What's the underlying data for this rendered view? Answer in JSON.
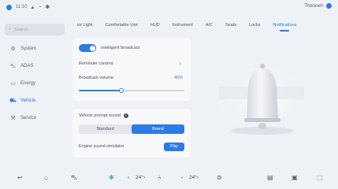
{
  "status_bar": {
    "time": "11:10",
    "left_glyphs": [
      "signal-icon",
      "wifi-icon",
      "bluetooth-icon"
    ],
    "right_text": "Theoneh",
    "right_glyph": "car-icon"
  },
  "sidebar": {
    "search_placeholder": "Search",
    "items": [
      {
        "label": "System",
        "icon": "gear-icon",
        "active": false
      },
      {
        "label": "ADAS",
        "icon": "car-front-icon",
        "active": false
      },
      {
        "label": "Energy",
        "icon": "battery-icon",
        "active": false
      },
      {
        "label": "Vehicle",
        "icon": "vehicle-icon",
        "active": true
      },
      {
        "label": "Service",
        "icon": "service-icon",
        "active": false
      }
    ]
  },
  "tabs": [
    {
      "label": "ior Light",
      "active": false
    },
    {
      "label": "Comfortable Use",
      "active": false
    },
    {
      "label": "HUD",
      "active": false
    },
    {
      "label": "Instrument",
      "active": false
    },
    {
      "label": "A/C",
      "active": false
    },
    {
      "label": "Seats",
      "active": false
    },
    {
      "label": "Locks",
      "active": false
    },
    {
      "label": "Notifications",
      "active": true
    }
  ],
  "broadcast_card": {
    "toggle_label": "Intelligent broadcast",
    "reminder_label": "Reminder content",
    "volume_label": "Broadcast volume",
    "volume_value_text": "40%",
    "volume_fraction": 0.4
  },
  "prompt_card": {
    "title": "Vehicle prompt sound",
    "options": [
      "Standard",
      "Brand"
    ],
    "selected": "Brand",
    "engine_label": "Engine sound simulator",
    "engine_button": "Play"
  },
  "dock": {
    "left_temp": "24",
    "right_temp": "24",
    "icons": [
      "back-icon",
      "home-icon",
      "car-icon",
      "fan-icon",
      "seat-icon",
      "steering-icon",
      "seat-heat-icon",
      "grid-icon",
      "settings-icon"
    ]
  },
  "colors": {
    "accent": "#2d7be5",
    "background": "#eef1f5",
    "card": "#f7f8fa"
  }
}
